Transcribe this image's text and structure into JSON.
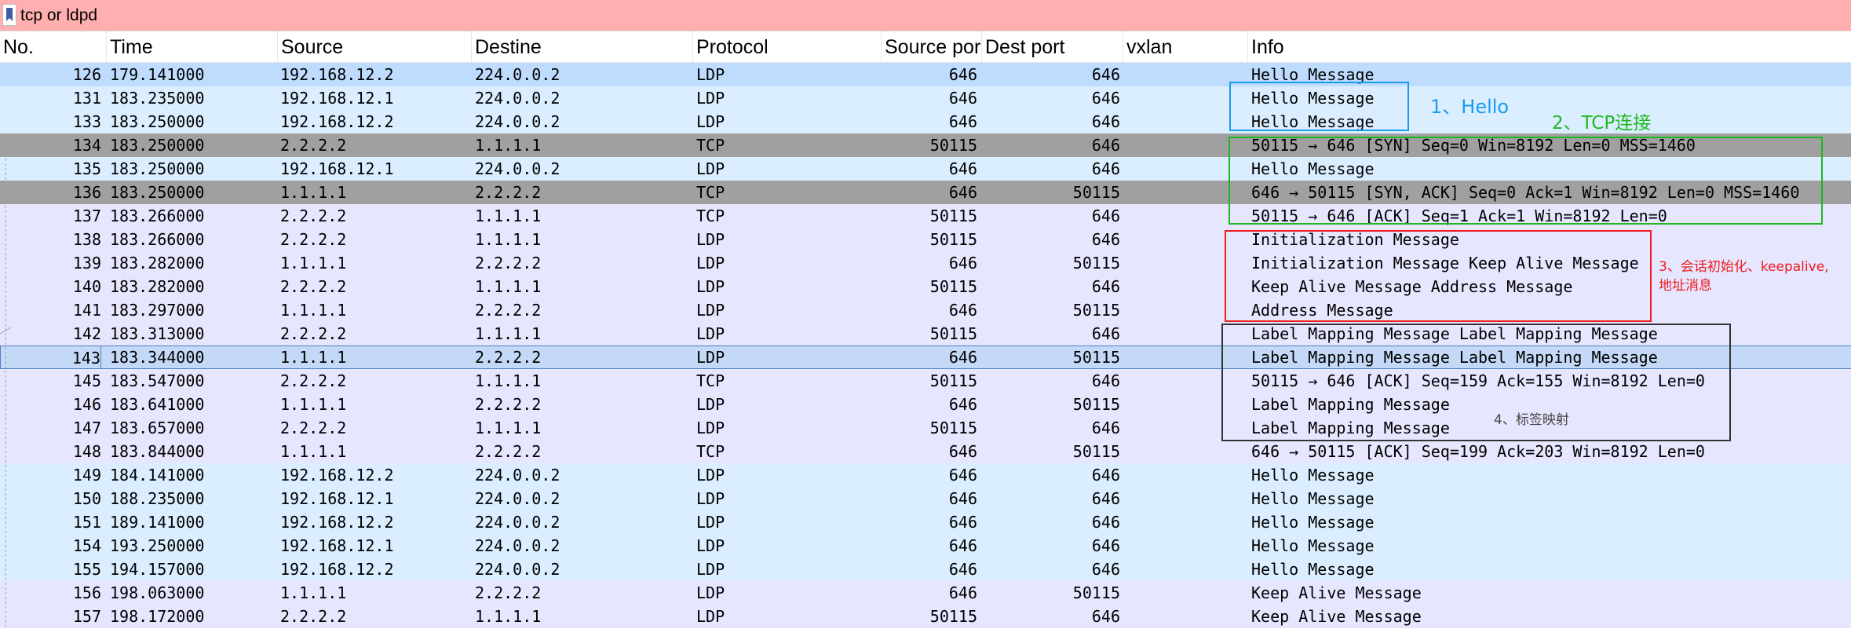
{
  "filter": {
    "text": "tcp or ldpd",
    "bar_color": "#ffafaf",
    "icon": "bookmark-icon"
  },
  "columns": [
    "No.",
    "Time",
    "Source",
    "Destine",
    "Protocol",
    "Source por",
    "Dest port",
    "vxlan",
    "Info"
  ],
  "colors": {
    "ldp_row": "#e7e6ff",
    "hello_row": "#daeeff",
    "tcp_handshake_row": "#a0a0a0",
    "selected_row": "#c4d9f7",
    "first_row": "#bfdcff",
    "selection_border": "#4f7fc0"
  },
  "packets": [
    {
      "no": "126",
      "time": "179.141000",
      "src": "192.168.12.2",
      "dst": "224.0.0.2",
      "proto": "LDP",
      "sport": "646",
      "dport": "646",
      "vxlan": "",
      "info": "Hello Message",
      "color": "#bfdcff"
    },
    {
      "no": "131",
      "time": "183.235000",
      "src": "192.168.12.1",
      "dst": "224.0.0.2",
      "proto": "LDP",
      "sport": "646",
      "dport": "646",
      "vxlan": "",
      "info": "Hello Message",
      "color": "#daeeff"
    },
    {
      "no": "133",
      "time": "183.250000",
      "src": "192.168.12.2",
      "dst": "224.0.0.2",
      "proto": "LDP",
      "sport": "646",
      "dport": "646",
      "vxlan": "",
      "info": "Hello Message",
      "color": "#daeeff"
    },
    {
      "no": "134",
      "time": "183.250000",
      "src": "2.2.2.2",
      "dst": "1.1.1.1",
      "proto": "TCP",
      "sport": "50115",
      "dport": "646",
      "vxlan": "",
      "info": "50115 → 646 [SYN] Seq=0 Win=8192 Len=0 MSS=1460",
      "color": "#a0a0a0"
    },
    {
      "no": "135",
      "time": "183.250000",
      "src": "192.168.12.1",
      "dst": "224.0.0.2",
      "proto": "LDP",
      "sport": "646",
      "dport": "646",
      "vxlan": "",
      "info": "Hello Message",
      "color": "#daeeff"
    },
    {
      "no": "136",
      "time": "183.250000",
      "src": "1.1.1.1",
      "dst": "2.2.2.2",
      "proto": "TCP",
      "sport": "646",
      "dport": "50115",
      "vxlan": "",
      "info": "646 → 50115 [SYN, ACK] Seq=0 Ack=1 Win=8192 Len=0 MSS=1460",
      "color": "#a0a0a0"
    },
    {
      "no": "137",
      "time": "183.266000",
      "src": "2.2.2.2",
      "dst": "1.1.1.1",
      "proto": "TCP",
      "sport": "50115",
      "dport": "646",
      "vxlan": "",
      "info": "50115 → 646 [ACK] Seq=1 Ack=1 Win=8192 Len=0",
      "color": "#e7e6ff"
    },
    {
      "no": "138",
      "time": "183.266000",
      "src": "2.2.2.2",
      "dst": "1.1.1.1",
      "proto": "LDP",
      "sport": "50115",
      "dport": "646",
      "vxlan": "",
      "info": "Initialization Message",
      "color": "#e7e6ff"
    },
    {
      "no": "139",
      "time": "183.282000",
      "src": "1.1.1.1",
      "dst": "2.2.2.2",
      "proto": "LDP",
      "sport": "646",
      "dport": "50115",
      "vxlan": "",
      "info": "Initialization Message Keep Alive Message",
      "color": "#e7e6ff"
    },
    {
      "no": "140",
      "time": "183.282000",
      "src": "2.2.2.2",
      "dst": "1.1.1.1",
      "proto": "LDP",
      "sport": "50115",
      "dport": "646",
      "vxlan": "",
      "info": "Keep Alive Message Address Message",
      "color": "#e7e6ff"
    },
    {
      "no": "141",
      "time": "183.297000",
      "src": "1.1.1.1",
      "dst": "2.2.2.2",
      "proto": "LDP",
      "sport": "646",
      "dport": "50115",
      "vxlan": "",
      "info": "Address Message",
      "color": "#e7e6ff"
    },
    {
      "no": "142",
      "time": "183.313000",
      "src": "2.2.2.2",
      "dst": "1.1.1.1",
      "proto": "LDP",
      "sport": "50115",
      "dport": "646",
      "vxlan": "",
      "info": "Label Mapping Message Label Mapping Message",
      "color": "#e7e6ff"
    },
    {
      "no": "143",
      "time": "183.344000",
      "src": "1.1.1.1",
      "dst": "2.2.2.2",
      "proto": "LDP",
      "sport": "646",
      "dport": "50115",
      "vxlan": "",
      "info": "Label Mapping Message Label Mapping Message",
      "color": "#c4d9f7",
      "selected": true
    },
    {
      "no": "145",
      "time": "183.547000",
      "src": "2.2.2.2",
      "dst": "1.1.1.1",
      "proto": "TCP",
      "sport": "50115",
      "dport": "646",
      "vxlan": "",
      "info": "50115 → 646 [ACK] Seq=159 Ack=155 Win=8192 Len=0",
      "color": "#e7e6ff"
    },
    {
      "no": "146",
      "time": "183.641000",
      "src": "1.1.1.1",
      "dst": "2.2.2.2",
      "proto": "LDP",
      "sport": "646",
      "dport": "50115",
      "vxlan": "",
      "info": "Label Mapping Message",
      "color": "#e7e6ff"
    },
    {
      "no": "147",
      "time": "183.657000",
      "src": "2.2.2.2",
      "dst": "1.1.1.1",
      "proto": "LDP",
      "sport": "50115",
      "dport": "646",
      "vxlan": "",
      "info": "Label Mapping Message",
      "color": "#e7e6ff"
    },
    {
      "no": "148",
      "time": "183.844000",
      "src": "1.1.1.1",
      "dst": "2.2.2.2",
      "proto": "TCP",
      "sport": "646",
      "dport": "50115",
      "vxlan": "",
      "info": "646 → 50115 [ACK] Seq=199 Ack=203 Win=8192 Len=0",
      "color": "#e7e6ff"
    },
    {
      "no": "149",
      "time": "184.141000",
      "src": "192.168.12.2",
      "dst": "224.0.0.2",
      "proto": "LDP",
      "sport": "646",
      "dport": "646",
      "vxlan": "",
      "info": "Hello Message",
      "color": "#daeeff"
    },
    {
      "no": "150",
      "time": "188.235000",
      "src": "192.168.12.1",
      "dst": "224.0.0.2",
      "proto": "LDP",
      "sport": "646",
      "dport": "646",
      "vxlan": "",
      "info": "Hello Message",
      "color": "#daeeff"
    },
    {
      "no": "151",
      "time": "189.141000",
      "src": "192.168.12.2",
      "dst": "224.0.0.2",
      "proto": "LDP",
      "sport": "646",
      "dport": "646",
      "vxlan": "",
      "info": "Hello Message",
      "color": "#daeeff"
    },
    {
      "no": "154",
      "time": "193.250000",
      "src": "192.168.12.1",
      "dst": "224.0.0.2",
      "proto": "LDP",
      "sport": "646",
      "dport": "646",
      "vxlan": "",
      "info": "Hello Message",
      "color": "#daeeff"
    },
    {
      "no": "155",
      "time": "194.157000",
      "src": "192.168.12.2",
      "dst": "224.0.0.2",
      "proto": "LDP",
      "sport": "646",
      "dport": "646",
      "vxlan": "",
      "info": "Hello Message",
      "color": "#daeeff"
    },
    {
      "no": "156",
      "time": "198.063000",
      "src": "1.1.1.1",
      "dst": "2.2.2.2",
      "proto": "LDP",
      "sport": "646",
      "dport": "50115",
      "vxlan": "",
      "info": "Keep Alive Message",
      "color": "#e7e6ff"
    },
    {
      "no": "157",
      "time": "198.172000",
      "src": "2.2.2.2",
      "dst": "1.1.1.1",
      "proto": "LDP",
      "sport": "50115",
      "dport": "646",
      "vxlan": "",
      "info": "Keep Alive Message",
      "color": "#e7e6ff"
    }
  ],
  "annotations": [
    {
      "id": "hello",
      "text": "1、Hello",
      "color": "#1a9bef"
    },
    {
      "id": "tcp",
      "text": "2、TCP连接",
      "color": "#1eb81e"
    },
    {
      "id": "init",
      "line1": "3、会话初始化、keepalive,",
      "line2": "地址消息",
      "color": "#ee1c1c"
    },
    {
      "id": "label",
      "text": "4、标签映射",
      "color": "#444444"
    }
  ]
}
